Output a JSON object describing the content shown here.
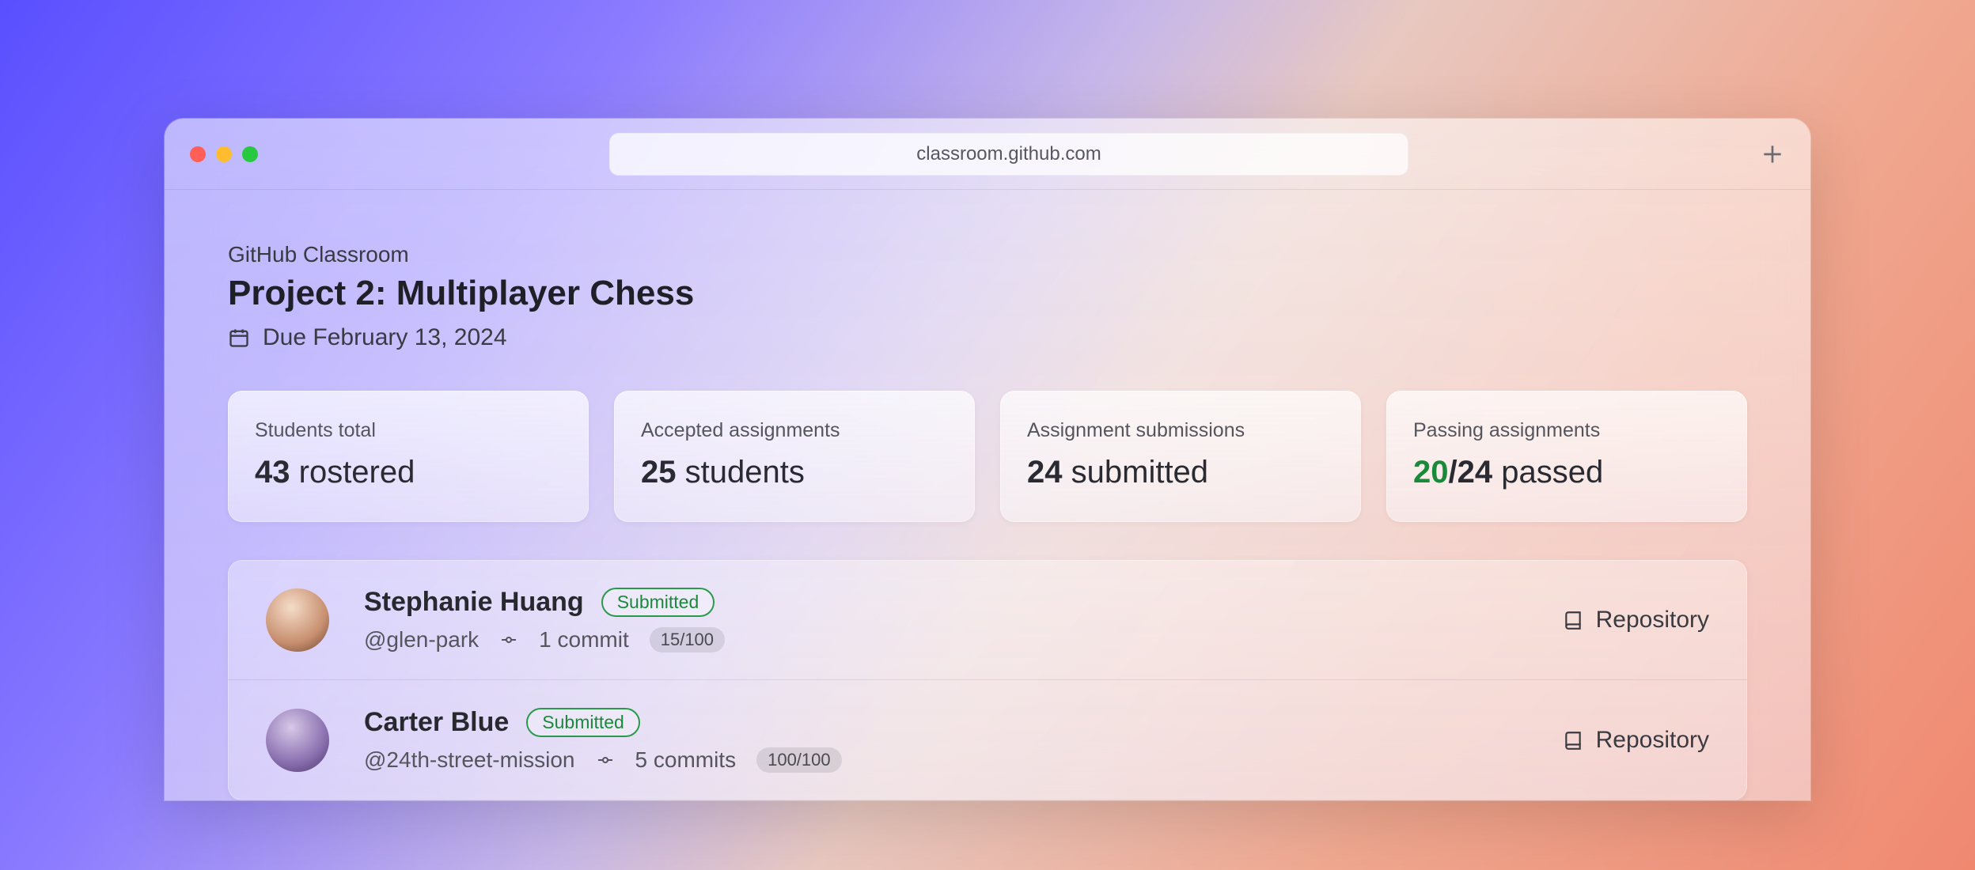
{
  "browser": {
    "url": "classroom.github.com"
  },
  "header": {
    "breadcrumb": "GitHub Classroom",
    "title": "Project 2: Multiplayer Chess",
    "due": "Due February 13, 2024"
  },
  "stats": {
    "students_total": {
      "label": "Students total",
      "value": "43",
      "suffix": "rostered"
    },
    "accepted": {
      "label": "Accepted assignments",
      "value": "25",
      "suffix": "students"
    },
    "submissions": {
      "label": "Assignment submissions",
      "value": "24",
      "suffix": "submitted"
    },
    "passing": {
      "label": "Passing assignments",
      "numerator": "20",
      "rest": "/24",
      "suffix": "passed"
    }
  },
  "students": [
    {
      "name": "Stephanie Huang",
      "status": "Submitted",
      "handle": "@glen-park",
      "commits": "1 commit",
      "score": "15/100",
      "repo_label": "Repository"
    },
    {
      "name": "Carter Blue",
      "status": "Submitted",
      "handle": "@24th-street-mission",
      "commits": "5 commits",
      "score": "100/100",
      "repo_label": "Repository"
    }
  ]
}
